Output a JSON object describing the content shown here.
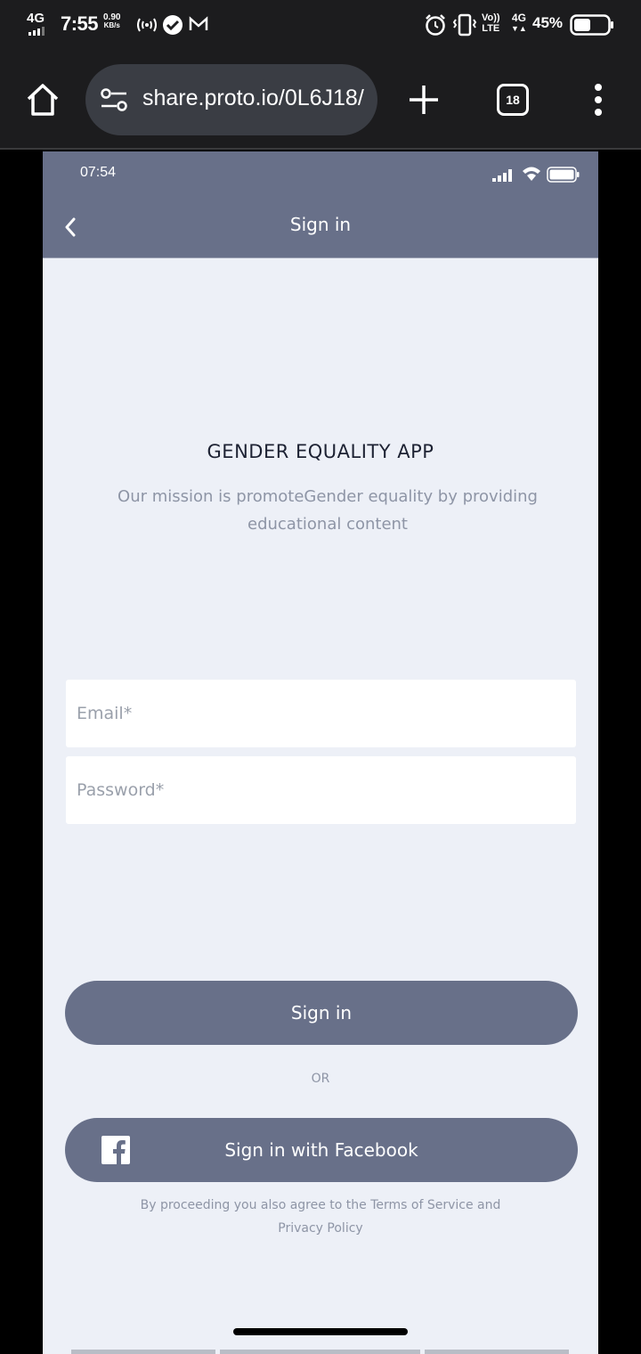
{
  "system_status": {
    "network_type": "4G",
    "time": "7:55",
    "net_speed_value": "0.90",
    "net_speed_unit": "KB/s",
    "volte_top": "Vo))",
    "volte_bottom": "LTE",
    "data_network": "4G",
    "battery_percent": "45%",
    "icons": [
      "signal-bars-icon",
      "hotspot-icon",
      "check-circle-icon",
      "gmail-icon",
      "alarm-icon",
      "vibrate-icon",
      "battery-icon"
    ]
  },
  "browser": {
    "url": "share.proto.io/0L6J18/",
    "tabs_count": "18",
    "icons": [
      "home-icon",
      "site-settings-icon",
      "new-tab-icon",
      "more-menu-icon"
    ]
  },
  "phone": {
    "status_time": "07:54",
    "header_title": "Sign in",
    "app_title": "GENDER EQUALITY APP",
    "app_mission": "Our mission is promoteGender equality by providing educational content",
    "email_placeholder": "Email*",
    "password_placeholder": "Password*",
    "signin_button": "Sign in",
    "or_text": "OR",
    "facebook_button": "Sign in with Facebook",
    "terms_text": "By proceeding you also agree to the Terms of Service and Privacy Policy"
  },
  "colors": {
    "header_bg": "#687089",
    "page_bg": "#edf0f7",
    "button_bg": "#687089",
    "muted_text": "#8e95a6",
    "title_text": "#1d2233"
  }
}
